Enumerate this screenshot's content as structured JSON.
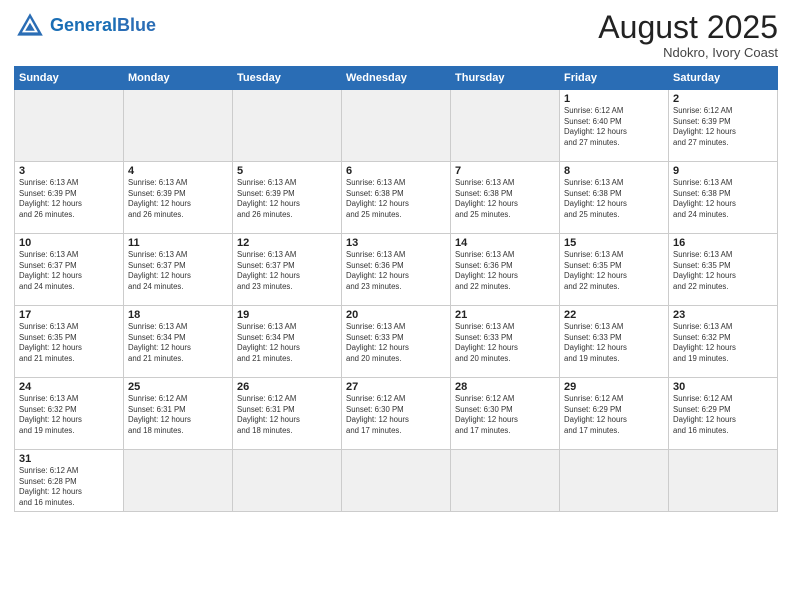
{
  "header": {
    "logo_general": "General",
    "logo_blue": "Blue",
    "month_title": "August 2025",
    "location": "Ndokro, Ivory Coast"
  },
  "weekdays": [
    "Sunday",
    "Monday",
    "Tuesday",
    "Wednesday",
    "Thursday",
    "Friday",
    "Saturday"
  ],
  "weeks": [
    [
      {
        "day": "",
        "info": ""
      },
      {
        "day": "",
        "info": ""
      },
      {
        "day": "",
        "info": ""
      },
      {
        "day": "",
        "info": ""
      },
      {
        "day": "",
        "info": ""
      },
      {
        "day": "1",
        "info": "Sunrise: 6:12 AM\nSunset: 6:40 PM\nDaylight: 12 hours\nand 27 minutes."
      },
      {
        "day": "2",
        "info": "Sunrise: 6:12 AM\nSunset: 6:39 PM\nDaylight: 12 hours\nand 27 minutes."
      }
    ],
    [
      {
        "day": "3",
        "info": "Sunrise: 6:13 AM\nSunset: 6:39 PM\nDaylight: 12 hours\nand 26 minutes."
      },
      {
        "day": "4",
        "info": "Sunrise: 6:13 AM\nSunset: 6:39 PM\nDaylight: 12 hours\nand 26 minutes."
      },
      {
        "day": "5",
        "info": "Sunrise: 6:13 AM\nSunset: 6:39 PM\nDaylight: 12 hours\nand 26 minutes."
      },
      {
        "day": "6",
        "info": "Sunrise: 6:13 AM\nSunset: 6:38 PM\nDaylight: 12 hours\nand 25 minutes."
      },
      {
        "day": "7",
        "info": "Sunrise: 6:13 AM\nSunset: 6:38 PM\nDaylight: 12 hours\nand 25 minutes."
      },
      {
        "day": "8",
        "info": "Sunrise: 6:13 AM\nSunset: 6:38 PM\nDaylight: 12 hours\nand 25 minutes."
      },
      {
        "day": "9",
        "info": "Sunrise: 6:13 AM\nSunset: 6:38 PM\nDaylight: 12 hours\nand 24 minutes."
      }
    ],
    [
      {
        "day": "10",
        "info": "Sunrise: 6:13 AM\nSunset: 6:37 PM\nDaylight: 12 hours\nand 24 minutes."
      },
      {
        "day": "11",
        "info": "Sunrise: 6:13 AM\nSunset: 6:37 PM\nDaylight: 12 hours\nand 24 minutes."
      },
      {
        "day": "12",
        "info": "Sunrise: 6:13 AM\nSunset: 6:37 PM\nDaylight: 12 hours\nand 23 minutes."
      },
      {
        "day": "13",
        "info": "Sunrise: 6:13 AM\nSunset: 6:36 PM\nDaylight: 12 hours\nand 23 minutes."
      },
      {
        "day": "14",
        "info": "Sunrise: 6:13 AM\nSunset: 6:36 PM\nDaylight: 12 hours\nand 22 minutes."
      },
      {
        "day": "15",
        "info": "Sunrise: 6:13 AM\nSunset: 6:35 PM\nDaylight: 12 hours\nand 22 minutes."
      },
      {
        "day": "16",
        "info": "Sunrise: 6:13 AM\nSunset: 6:35 PM\nDaylight: 12 hours\nand 22 minutes."
      }
    ],
    [
      {
        "day": "17",
        "info": "Sunrise: 6:13 AM\nSunset: 6:35 PM\nDaylight: 12 hours\nand 21 minutes."
      },
      {
        "day": "18",
        "info": "Sunrise: 6:13 AM\nSunset: 6:34 PM\nDaylight: 12 hours\nand 21 minutes."
      },
      {
        "day": "19",
        "info": "Sunrise: 6:13 AM\nSunset: 6:34 PM\nDaylight: 12 hours\nand 21 minutes."
      },
      {
        "day": "20",
        "info": "Sunrise: 6:13 AM\nSunset: 6:33 PM\nDaylight: 12 hours\nand 20 minutes."
      },
      {
        "day": "21",
        "info": "Sunrise: 6:13 AM\nSunset: 6:33 PM\nDaylight: 12 hours\nand 20 minutes."
      },
      {
        "day": "22",
        "info": "Sunrise: 6:13 AM\nSunset: 6:33 PM\nDaylight: 12 hours\nand 19 minutes."
      },
      {
        "day": "23",
        "info": "Sunrise: 6:13 AM\nSunset: 6:32 PM\nDaylight: 12 hours\nand 19 minutes."
      }
    ],
    [
      {
        "day": "24",
        "info": "Sunrise: 6:13 AM\nSunset: 6:32 PM\nDaylight: 12 hours\nand 19 minutes."
      },
      {
        "day": "25",
        "info": "Sunrise: 6:12 AM\nSunset: 6:31 PM\nDaylight: 12 hours\nand 18 minutes."
      },
      {
        "day": "26",
        "info": "Sunrise: 6:12 AM\nSunset: 6:31 PM\nDaylight: 12 hours\nand 18 minutes."
      },
      {
        "day": "27",
        "info": "Sunrise: 6:12 AM\nSunset: 6:30 PM\nDaylight: 12 hours\nand 17 minutes."
      },
      {
        "day": "28",
        "info": "Sunrise: 6:12 AM\nSunset: 6:30 PM\nDaylight: 12 hours\nand 17 minutes."
      },
      {
        "day": "29",
        "info": "Sunrise: 6:12 AM\nSunset: 6:29 PM\nDaylight: 12 hours\nand 17 minutes."
      },
      {
        "day": "30",
        "info": "Sunrise: 6:12 AM\nSunset: 6:29 PM\nDaylight: 12 hours\nand 16 minutes."
      }
    ],
    [
      {
        "day": "31",
        "info": "Sunrise: 6:12 AM\nSunset: 6:28 PM\nDaylight: 12 hours\nand 16 minutes."
      },
      {
        "day": "",
        "info": ""
      },
      {
        "day": "",
        "info": ""
      },
      {
        "day": "",
        "info": ""
      },
      {
        "day": "",
        "info": ""
      },
      {
        "day": "",
        "info": ""
      },
      {
        "day": "",
        "info": ""
      }
    ]
  ]
}
